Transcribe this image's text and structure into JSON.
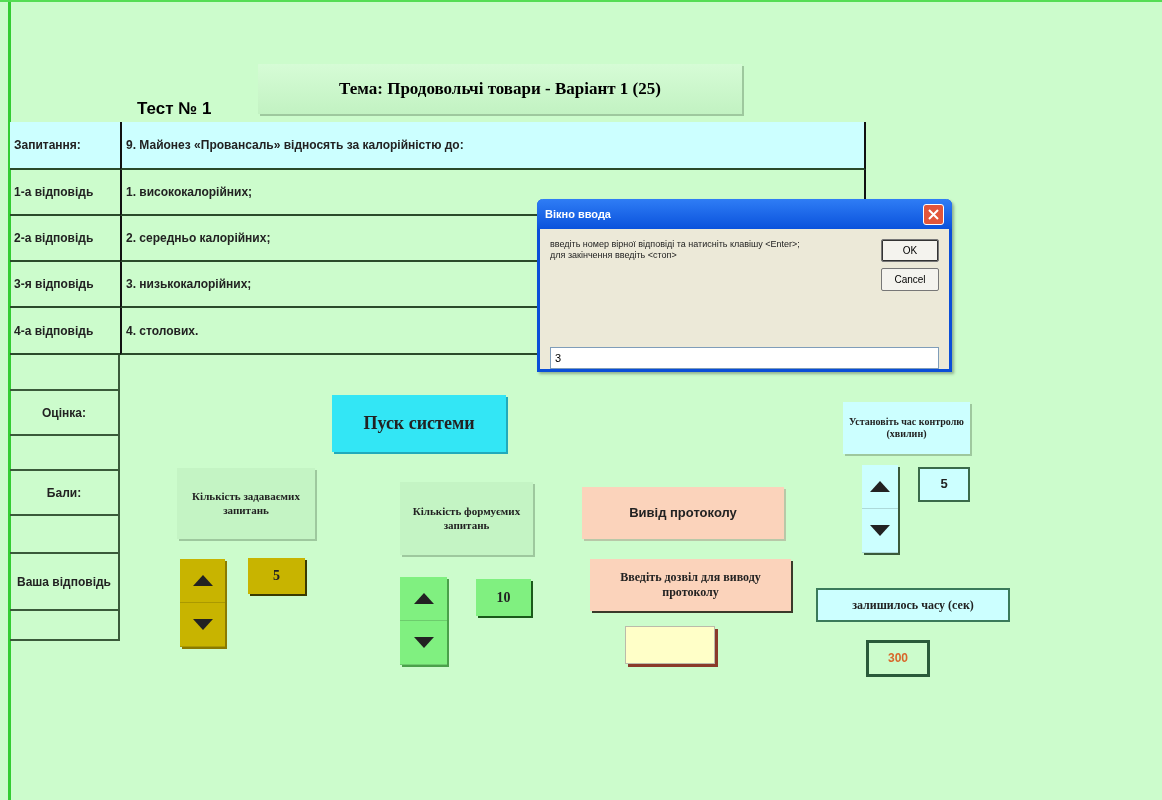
{
  "test_label": "Тест № 1",
  "topic": "Тема: Продовольчі товари - Варіант 1 (25)",
  "question": {
    "label": "Запитання:",
    "text": "9. Майонез «Провансаль» відносять за калорійністю до:"
  },
  "answers": [
    {
      "label": "1-а відповідь",
      "text": "1. висококалорійних;"
    },
    {
      "label": "2-а відповідь",
      "text": "2. середньо калорійних;"
    },
    {
      "label": "3-я відповідь",
      "text": "3. низькокалорійних;"
    },
    {
      "label": "4-а відповідь",
      "text": "4. столових."
    }
  ],
  "side_cells": [
    {
      "kind": "blank"
    },
    {
      "kind": "label",
      "text": "Оцінка:"
    },
    {
      "kind": "blank"
    },
    {
      "kind": "label",
      "text": "Бали:"
    },
    {
      "kind": "blank"
    },
    {
      "kind": "label",
      "text": "Ваша відповідь"
    },
    {
      "kind": "blank"
    }
  ],
  "start_button": "Пуск системи",
  "asked_count": {
    "label": "Кількість задаваємих запитань",
    "value": "5"
  },
  "formed_count": {
    "label": "Кількість формуємих запитань",
    "value": "10"
  },
  "protocol_button": "Вивід протоколу",
  "permission_label": "Введіть дозвіл для виводу протоколу",
  "timer": {
    "label": "Установіть час контролю (хвилин)",
    "value": "5"
  },
  "remaining": {
    "label": "залишилось часу (сек)",
    "value": "300"
  },
  "dialog": {
    "title": "Вікно ввода",
    "message": [
      "введіть номер вірної відповіді та натисніть клавішу <Enter>;",
      "для закінчення введіть <стоп>"
    ],
    "buttons": [
      "OK",
      "Cancel"
    ],
    "value": "3"
  }
}
